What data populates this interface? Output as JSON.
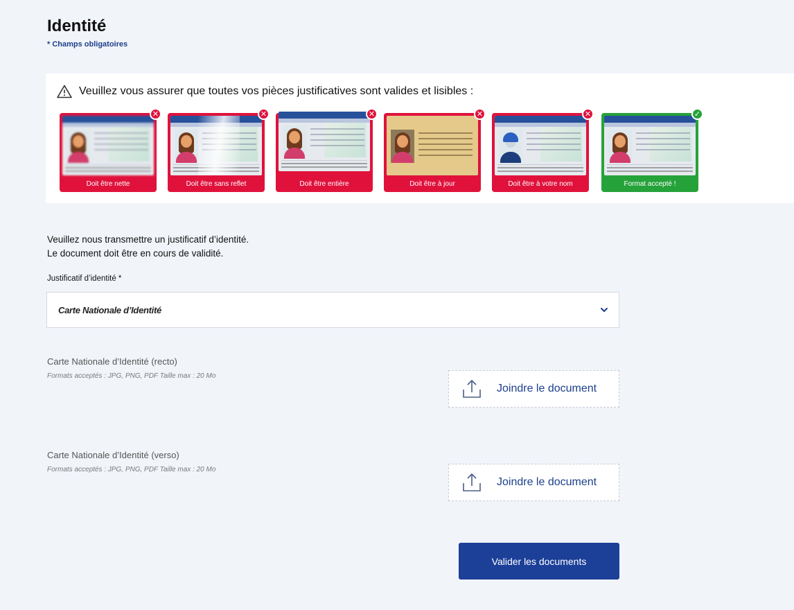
{
  "header": {
    "title": "Identité",
    "required_note": "* Champs obligatoires"
  },
  "warning": {
    "text": "Veuillez vous assurer que toutes vos pièces justificatives sont valides et lisibles :",
    "cards": [
      {
        "label": "Doit être nette",
        "status": "invalid",
        "badge": "✕"
      },
      {
        "label": "Doit être sans reflet",
        "status": "invalid",
        "badge": "✕"
      },
      {
        "label": "Doit être entière",
        "status": "invalid",
        "badge": "✕"
      },
      {
        "label": "Doit être à jour",
        "status": "invalid",
        "badge": "✕"
      },
      {
        "label": "Doit être à votre nom",
        "status": "invalid",
        "badge": "✕"
      },
      {
        "label": "Format accepté !",
        "status": "valid",
        "badge": "✓"
      }
    ]
  },
  "intro": {
    "line1": "Veuillez nous transmettre un justificatif d’identité.",
    "line2": "Le document doit être en cours de validité."
  },
  "id_select": {
    "label": "Justificatif d’identité *",
    "value": "Carte Nationale d’Identité"
  },
  "documents": [
    {
      "title": "Carte Nationale d’Identité (recto)",
      "formats": "Formats acceptés : JPG, PNG, PDF Taille max : 20 Mo",
      "upload_label": "Joindre le document"
    },
    {
      "title": "Carte Nationale d’Identité (verso)",
      "formats": "Formats acceptés : JPG, PNG, PDF Taille max : 20 Mo",
      "upload_label": "Joindre le document"
    }
  ],
  "submit": {
    "label": "Valider les documents"
  },
  "colors": {
    "brand_blue": "#1c3f98",
    "error_red": "#e0123c",
    "success_green": "#26a23a",
    "background": "#f1f4f9"
  },
  "icons": [
    "warning-triangle-icon",
    "chevron-down-icon",
    "upload-icon",
    "cross-icon",
    "check-icon"
  ]
}
